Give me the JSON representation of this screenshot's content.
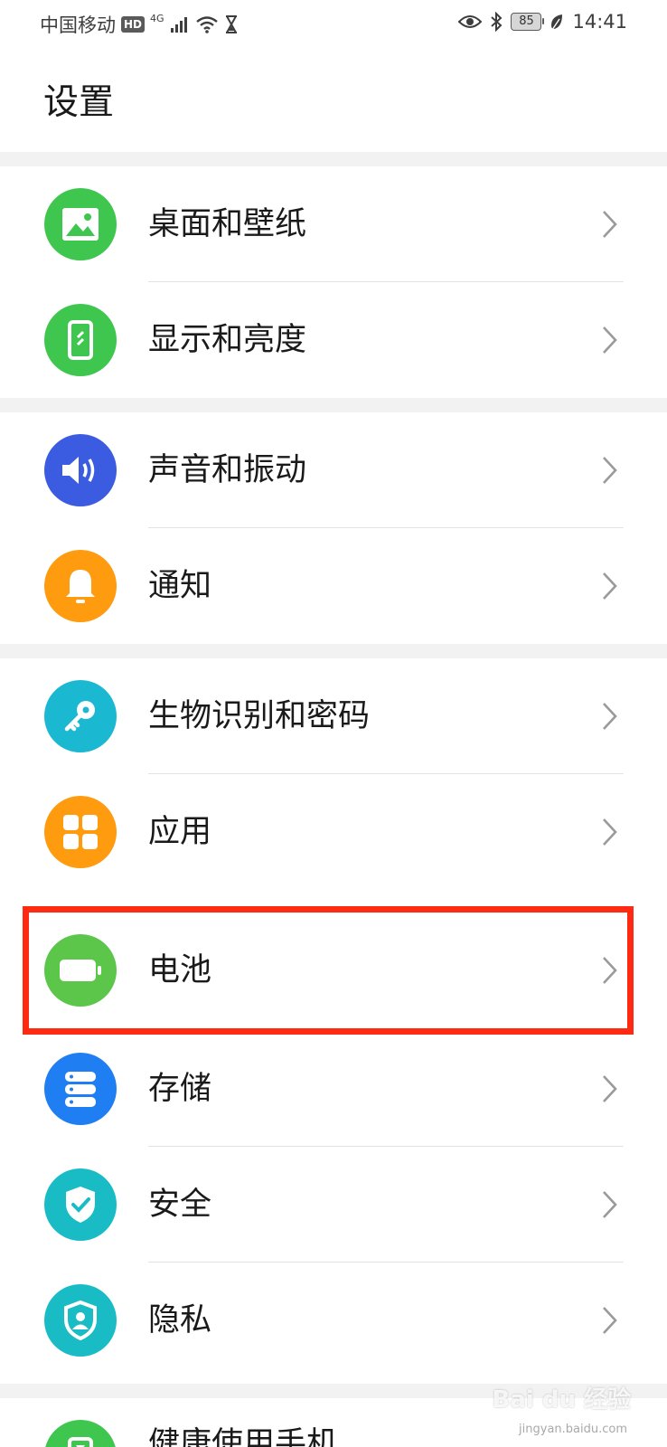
{
  "status_bar": {
    "carrier": "中国移动",
    "hd": "HD",
    "network": "4G",
    "battery_level": "85",
    "time": "14:41"
  },
  "title": "设置",
  "items": [
    {
      "label": "桌面和壁纸",
      "icon": "wallpaper-icon",
      "color": "#3fc64f"
    },
    {
      "label": "显示和亮度",
      "icon": "display-icon",
      "color": "#3fc64f"
    },
    {
      "label": "声音和振动",
      "icon": "speaker-icon",
      "color": "#3b5ce0"
    },
    {
      "label": "通知",
      "icon": "bell-icon",
      "color": "#ff9b0f"
    },
    {
      "label": "生物识别和密码",
      "icon": "key-icon",
      "color": "#1bb8d2"
    },
    {
      "label": "应用",
      "icon": "apps-grid-icon",
      "color": "#ff9b0f"
    },
    {
      "label": "电池",
      "icon": "battery-icon",
      "color": "#5cc64a"
    },
    {
      "label": "存储",
      "icon": "storage-icon",
      "color": "#1f7ef2"
    },
    {
      "label": "安全",
      "icon": "shield-check-icon",
      "color": "#19bcc4"
    },
    {
      "label": "隐私",
      "icon": "privacy-icon",
      "color": "#19bcc4"
    },
    {
      "label": "健康使用手机",
      "icon": "hourglass-phone-icon",
      "color": "#3fc64f"
    }
  ],
  "watermark": {
    "brand": "Bai du 经验",
    "url": "jingyan.baidu.com"
  }
}
